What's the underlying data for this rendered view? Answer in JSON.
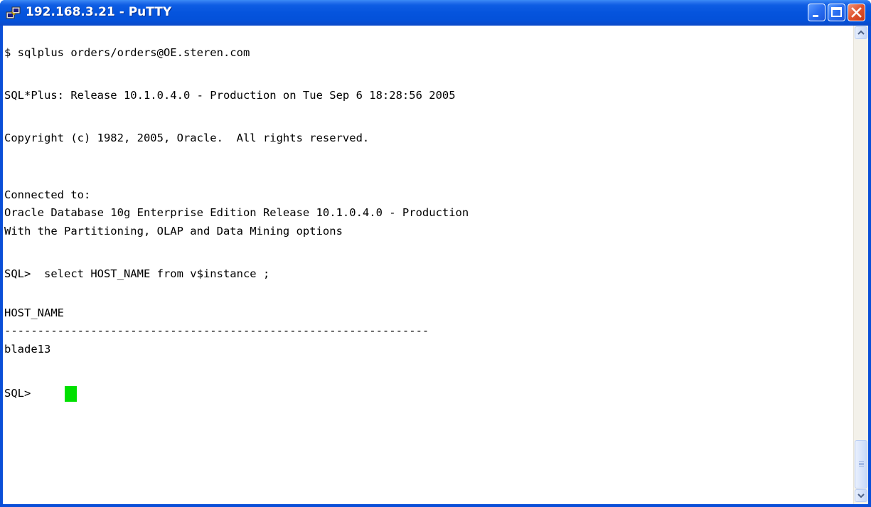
{
  "window": {
    "title": "192.168.3.21 - PuTTY",
    "icon": "putty-icon"
  },
  "titlebar_buttons": {
    "minimize": "minimize-icon",
    "maximize": "maximize-icon",
    "close": "close-icon"
  },
  "terminal": {
    "lines": [
      "$ sqlplus orders/orders@OE.steren.com",
      "",
      "SQL*Plus: Release 10.1.0.4.0 - Production on Tue Sep 6 18:28:56 2005",
      "",
      "Copyright (c) 1982, 2005, Oracle.  All rights reserved.",
      "",
      "",
      "Connected to:",
      "Oracle Database 10g Enterprise Edition Release 10.1.0.4.0 - Production",
      "With the Partitioning, OLAP and Data Mining options",
      "",
      "SQL>  select HOST_NAME from v$instance ;",
      "",
      "HOST_NAME",
      "----------------------------------------------------------------",
      "blade13",
      "",
      "SQL> "
    ],
    "cursor_color": "#00e000",
    "background": "#ffffff",
    "foreground": "#000000"
  }
}
